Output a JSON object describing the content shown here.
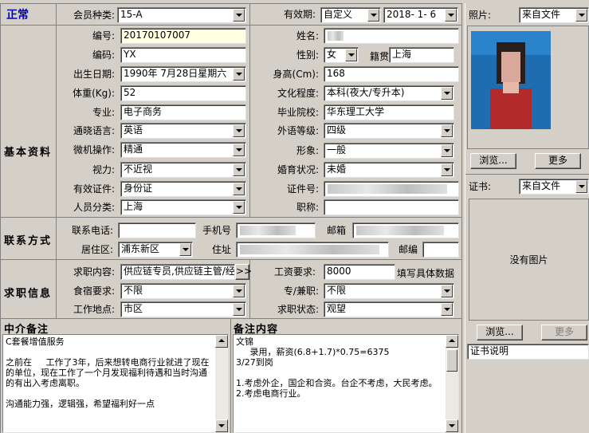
{
  "status": "正常",
  "membership": {
    "label": "会员种类:",
    "value": "15-A"
  },
  "validity": {
    "label": "有效期:",
    "type": "自定义",
    "date": "2018- 1- 6"
  },
  "photo": {
    "label": "照片:",
    "source": "来自文件",
    "browse": "浏览...",
    "more": "更多"
  },
  "basic": {
    "section": "基本资料",
    "id": {
      "label": "编号:",
      "value": "20170107007"
    },
    "code": {
      "label": "编码:",
      "value": "YX"
    },
    "birth": {
      "label": "出生日期:",
      "value": "1990年 7月28日星期六"
    },
    "weight": {
      "label": "体重(Kg):",
      "value": "52"
    },
    "major": {
      "label": "专业:",
      "value": "电子商务"
    },
    "lang": {
      "label": "通晓语言:",
      "value": "英语"
    },
    "computer": {
      "label": "微机操作:",
      "value": "精通"
    },
    "vision": {
      "label": "视力:",
      "value": "不近视"
    },
    "idcard": {
      "label": "有效证件:",
      "value": "身份证"
    },
    "category": {
      "label": "人员分类:",
      "value": "上海"
    },
    "name": {
      "label": "姓名:"
    },
    "gender": {
      "label": "性别:",
      "value": "女",
      "native_label": "籍贯",
      "native": "上海"
    },
    "height": {
      "label": "身高(Cm):",
      "value": "168"
    },
    "education": {
      "label": "文化程度:",
      "value": "本科(夜大/专升本)"
    },
    "school": {
      "label": "毕业院校:",
      "value": "华东理工大学"
    },
    "foreign": {
      "label": "外语等级:",
      "value": "四级"
    },
    "appearance": {
      "label": "形象:",
      "value": "一般"
    },
    "marital": {
      "label": "婚育状况:",
      "value": "未婚"
    },
    "certno": {
      "label": "证件号:"
    },
    "title": {
      "label": "职称:"
    }
  },
  "contact": {
    "section": "联系方式",
    "phone_label": "联系电话:",
    "mobile_label": "手机号",
    "email_label": "邮箱",
    "area_label": "居住区:",
    "area": "浦东新区",
    "address_label": "住址",
    "zip_label": "邮编"
  },
  "job": {
    "section": "求职信息",
    "want_label": "求职内容:",
    "want": "供应链专员,供应链主管/经",
    "want_more": ">>",
    "salary_label": "工资要求:",
    "salary": "8000",
    "salary_hint": "填写具体数据",
    "food_label": "食宿要求:",
    "food": "不限",
    "type_label": "专/兼职:",
    "type": "不限",
    "place_label": "工作地点:",
    "place": "市区",
    "state_label": "求职状态:",
    "state": "观望"
  },
  "agency_note": {
    "title": "中介备注",
    "text": "C套餐增值服务\n\n之前在     工作了3年，后来想转电商行业就进了现在的单位，现在工作了一个月发现福利待遇和当时沟通的有出入考虑离职。\n\n沟通能力强，逻辑强，希望福利好一点"
  },
  "remark": {
    "title": "备注内容",
    "text": "文锦\n     录用，薪资(6.8+1.7)*0.75=6375\n3/27到岗\n\n1.考虑外企，国企和合资。台企不考虑，大民考虑。\n2.考虑电商行业。"
  },
  "certificate": {
    "label": "证书:",
    "source": "来自文件",
    "no_image": "没有图片",
    "browse": "浏览...",
    "more": "更多",
    "desc": "证书说明"
  }
}
